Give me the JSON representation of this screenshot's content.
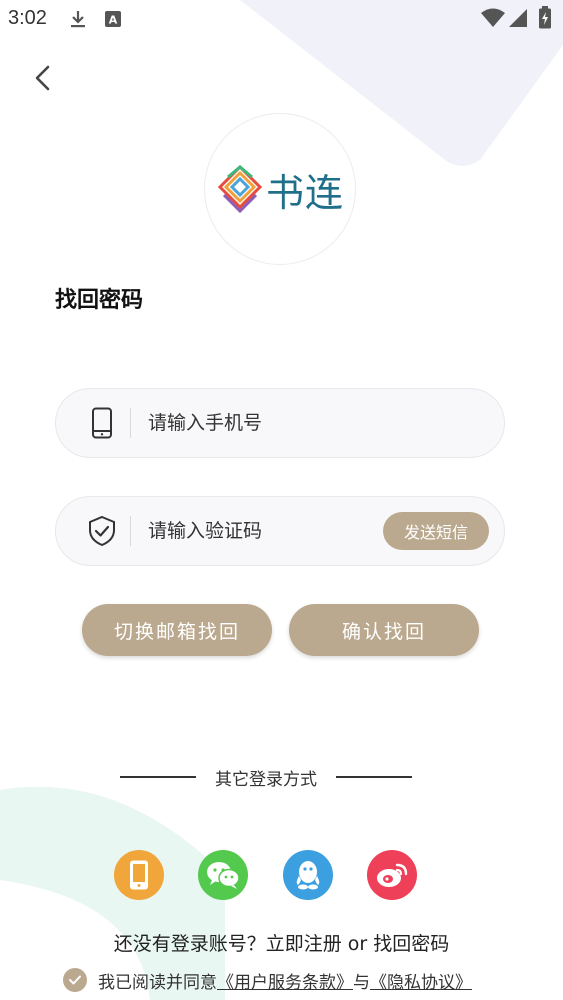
{
  "status_bar": {
    "time": "3:02"
  },
  "app": {
    "logo_text": "书连"
  },
  "page": {
    "title": "找回密码"
  },
  "form": {
    "phone_placeholder": "请输入手机号",
    "code_placeholder": "请输入验证码",
    "send_sms_label": "发送短信"
  },
  "actions": {
    "switch_email_label": "切换邮箱找回",
    "confirm_label": "确认找回"
  },
  "other_login": {
    "label": "其它登录方式",
    "methods": [
      "phone",
      "wechat",
      "qq",
      "weibo"
    ]
  },
  "footer": {
    "register_text": "还没有登录账号？立即注册 or 找回密码",
    "agree_prefix": "我已阅读并同意",
    "terms_link": "《用户服务条款》",
    "and_text": "与",
    "privacy_link": "《隐私协议》"
  },
  "colors": {
    "accent": "#bba98f",
    "logo_text": "#1f6f8b",
    "phone_login": "#f0a63a",
    "wechat_login": "#53c94d",
    "qq_login": "#3b9fe0",
    "weibo_login": "#ef4059"
  }
}
